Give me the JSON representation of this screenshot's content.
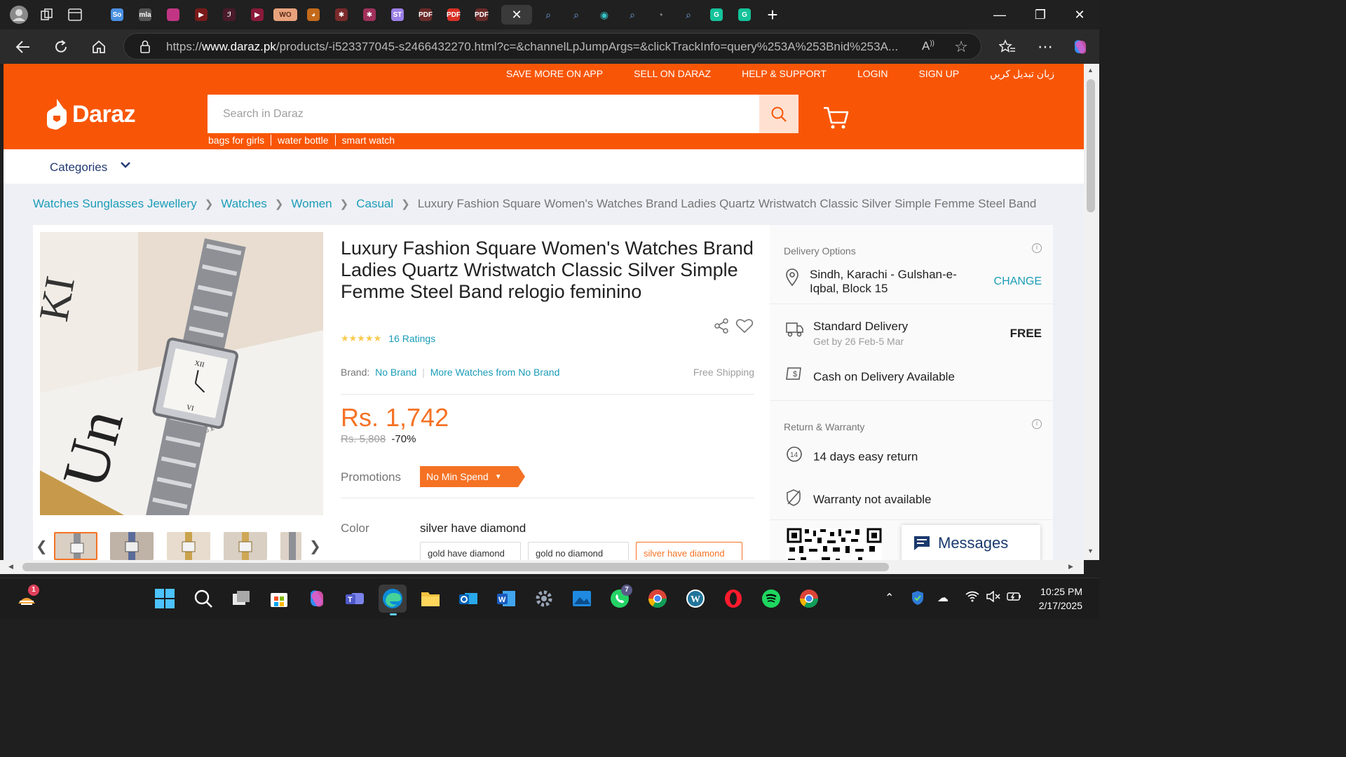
{
  "browser": {
    "url_prefix": "https://",
    "url_domain": "www.daraz.pk",
    "url_rest": "/products/-i523377045-s2466432270.html?c=&channelLpJumpArgs=&clickTrackInfo=query%253A%253Bnid%253A...",
    "tabs": [
      {
        "label": "So",
        "bg": "#4a90e2"
      },
      {
        "label": "mla",
        "bg": "#555555"
      },
      {
        "label": "",
        "bg": "#c13584"
      },
      {
        "label": "▶",
        "bg": "#7a1a1a"
      },
      {
        "label": "ℐ",
        "bg": "#4a1a2a"
      },
      {
        "label": "▶",
        "bg": "#8b1a3a"
      },
      {
        "label": "WO",
        "bg": "#e8a27c"
      },
      {
        "label": "◕",
        "bg": "#c46a1a"
      },
      {
        "label": "✱",
        "bg": "#7a2a2a"
      },
      {
        "label": "✱",
        "bg": "#a0305a"
      },
      {
        "label": "ST",
        "bg": "#9b7fe6"
      },
      {
        "label": "PDF",
        "bg": "#6a2a2a"
      },
      {
        "label": "PDF",
        "bg": "#d93025"
      },
      {
        "label": "PDF",
        "bg": "#6a2a2a"
      }
    ]
  },
  "header": {
    "toplinks": [
      "SAVE MORE ON APP",
      "SELL ON DARAZ",
      "HELP & SUPPORT",
      "LOGIN",
      "SIGN UP",
      "زبان تبدیل کریں"
    ],
    "logo_text": "Daraz",
    "search_placeholder": "Search in Daraz",
    "suggestions": [
      "bags for girls",
      "water bottle",
      "smart watch"
    ],
    "categories_label": "Categories"
  },
  "breadcrumb": {
    "items": [
      "Watches Sunglasses Jewellery",
      "Watches",
      "Women",
      "Casual"
    ],
    "current": "Luxury Fashion Square Women's Watches Brand Ladies Quartz Wristwatch Classic Silver Simple Femme Steel Band"
  },
  "product": {
    "title": "Luxury Fashion Square Women's Watches Brand Ladies Quartz Wristwatch Classic Silver Simple Femme Steel Band relogio feminino",
    "stars": "★★★★★",
    "ratings": "16 Ratings",
    "brand_label": "Brand:",
    "brand": "No Brand",
    "more_from": "More Watches from No Brand",
    "free_shipping": "Free Shipping",
    "price": "Rs. 1,742",
    "old_price": "Rs. 5,808",
    "discount": "-70%",
    "promotions_label": "Promotions",
    "promotion_tag": "No Min Spend",
    "color_label": "Color",
    "color_value": "silver have diamond",
    "color_options": [
      "gold have diamond",
      "gold no diamond",
      "silver have diamond"
    ]
  },
  "delivery": {
    "title": "Delivery Options",
    "location": "Sindh, Karachi - Gulshan-e-Iqbal, Block 15",
    "change": "CHANGE",
    "standard": "Standard Delivery",
    "standard_eta": "Get by 26 Feb-5 Mar",
    "standard_price": "FREE",
    "cod": "Cash on Delivery Available",
    "return_title": "Return & Warranty",
    "return_text": "14 days easy return",
    "warranty_text": "Warranty not available"
  },
  "messages_label": "Messages",
  "taskbar": {
    "time": "10:25 PM",
    "date": "2/17/2025",
    "whatsapp_badge": "7",
    "widget_badge": "1"
  },
  "colors": {
    "brand_orange": "#f85606",
    "price_orange": "#f57224",
    "link_teal": "#1a9cb7"
  }
}
